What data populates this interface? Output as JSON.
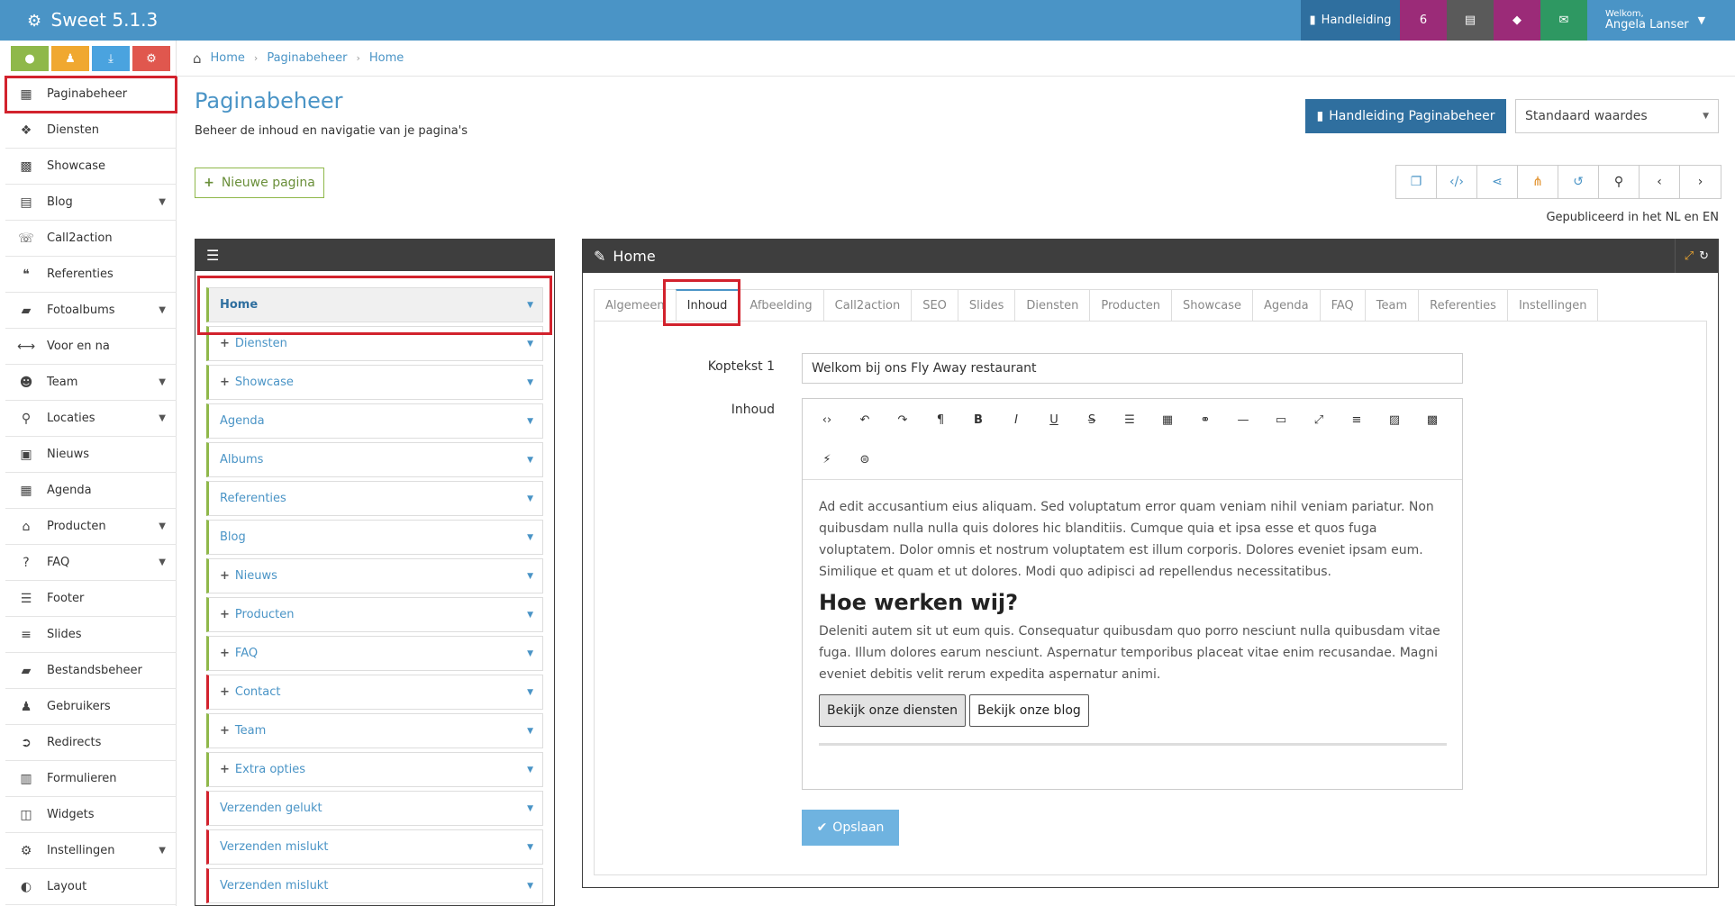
{
  "app": {
    "title": "Sweet 5.1.3"
  },
  "topbar": {
    "manual_label": "Handleiding",
    "count": "6",
    "welcome": "Welkom,",
    "user_name": "Angela Lanser"
  },
  "sidebar": {
    "items": [
      {
        "label": "Paginabeheer",
        "icon": "table-icon"
      },
      {
        "label": "Diensten",
        "icon": "cubes-icon"
      },
      {
        "label": "Showcase",
        "icon": "grid-icon"
      },
      {
        "label": "Blog",
        "icon": "document-icon"
      },
      {
        "label": "Call2action",
        "icon": "phone-icon"
      },
      {
        "label": "Referenties",
        "icon": "comments-icon"
      },
      {
        "label": "Fotoalbums",
        "icon": "book-icon"
      },
      {
        "label": "Voor en na",
        "icon": "arrows-icon"
      },
      {
        "label": "Team",
        "icon": "users-icon"
      },
      {
        "label": "Locaties",
        "icon": "map-marker-icon"
      },
      {
        "label": "Nieuws",
        "icon": "newspaper-icon"
      },
      {
        "label": "Agenda",
        "icon": "calendar-icon"
      },
      {
        "label": "Producten",
        "icon": "tags-icon"
      },
      {
        "label": "FAQ",
        "icon": "question-icon"
      },
      {
        "label": "Footer",
        "icon": "list-icon"
      },
      {
        "label": "Slides",
        "icon": "sliders-icon"
      },
      {
        "label": "Bestandsbeheer",
        "icon": "folder-icon"
      },
      {
        "label": "Gebruikers",
        "icon": "user-icon"
      },
      {
        "label": "Redirects",
        "icon": "redirect-icon"
      },
      {
        "label": "Formulieren",
        "icon": "form-icon"
      },
      {
        "label": "Widgets",
        "icon": "widget-icon"
      },
      {
        "label": "Instellingen",
        "icon": "gear-icon"
      },
      {
        "label": "Layout",
        "icon": "palette-icon"
      }
    ]
  },
  "breadcrumb": {
    "items": [
      "Home",
      "Paginabeheer",
      "Home"
    ]
  },
  "page": {
    "title": "Paginabeheer",
    "subtitle": "Beheer de inhoud en navigatie van je pagina's",
    "manual_button": "Handleiding Paginabeheer",
    "select_value": "Standaard waardes",
    "new_page": "Nieuwe pagina",
    "published": "Gepubliceerd in het NL en EN"
  },
  "tree": {
    "items": [
      "Home",
      "Diensten",
      "Showcase",
      "Agenda",
      "Albums",
      "Referenties",
      "Blog",
      "Nieuws",
      "Producten",
      "FAQ",
      "Contact",
      "Team",
      "Extra opties",
      "Verzenden gelukt",
      "Verzenden mislukt",
      "Verzenden mislukt"
    ]
  },
  "content": {
    "title": "Home",
    "tabs": [
      "Algemeen",
      "Inhoud",
      "Afbeelding",
      "Call2action",
      "SEO",
      "Slides",
      "Diensten",
      "Producten",
      "Showcase",
      "Agenda",
      "FAQ",
      "Team",
      "Referenties",
      "Instellingen"
    ],
    "koptekst_label": "Koptekst 1",
    "koptekst_value": "Welkom bij ons Fly Away restaurant",
    "inhoud_label": "Inhoud",
    "paragraph1": "Ad edit accusantium eius aliquam. Sed voluptatum error quam veniam nihil veniam pariatur. Non quibusdam nulla nulla quis dolores hic blanditiis. Cumque quia et ipsa esse et quos fuga voluptatem. Dolor omnis et nostrum voluptatem est illum corporis. Dolores eveniet ipsam eum. Similique et quam et ut dolores. Modi quo adipisci ad repellendus necessitatibus.",
    "heading": "Hoe werken wij?",
    "paragraph2": "Deleniti autem sit ut eum quis. Consequatur quibusdam quo porro nesciunt nulla quibusdam vitae fuga. Illum dolores earum nesciunt. Aspernatur temporibus placeat vitae enim recusandae. Magni eveniet debitis velit rerum expedita aspernatur animi.",
    "btn1": "Bekijk onze diensten",
    "btn2": "Bekijk onze blog",
    "save": "Opslaan"
  },
  "colors": {
    "topbar": "#4a94c6",
    "manual": "#2f6f9f",
    "highlight": "#d2222d",
    "green": "#8fb84a"
  }
}
